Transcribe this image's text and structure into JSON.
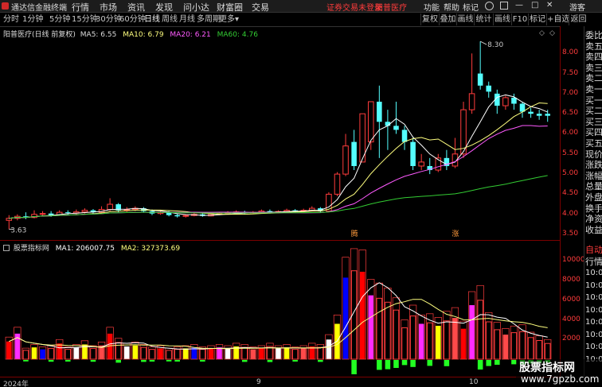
{
  "topbar": {
    "app_title": "通达信金融终端",
    "menu": [
      "行情",
      "市场",
      "资讯",
      "发现",
      "问小达",
      "财富圈",
      "交易"
    ],
    "login_status": "证券交易未登录",
    "stock_name": "阳普医疗",
    "right_menu": [
      "功能",
      "帮助",
      "标记"
    ],
    "guest": "游客"
  },
  "periodbar": {
    "periods": [
      "分时",
      "1分钟",
      "5分钟",
      "15分钟",
      "30分钟",
      "60分钟",
      "日线",
      "周线",
      "月线",
      "多周期",
      "更多"
    ],
    "active": "日线",
    "tools": [
      "复权",
      "叠加",
      "画线",
      "统计",
      "画线",
      "F10",
      "标记",
      "+自选",
      "返回"
    ]
  },
  "main": {
    "header": {
      "title": "阳普医疗(日线 前复权)",
      "ma5": "MA5: 6.55",
      "ma10": "MA10: 6.79",
      "ma20": "MA20: 6.21",
      "ma60": "MA60: 4.76"
    },
    "high_label": "8.30",
    "low_label": "3.63",
    "mark_left": "腾",
    "mark_right": "涨",
    "price_ticks": [
      "8.00",
      "7.50",
      "7.00",
      "6.50",
      "6.00",
      "5.50",
      "5.00",
      "4.50",
      "4.00",
      "3.50"
    ]
  },
  "volume": {
    "header": {
      "title": "股票指标网",
      "ma1": "MA1: 206007.75",
      "ma2": "MA2: 327373.69"
    },
    "ticks": [
      "10000",
      "8000",
      "6000",
      "4000",
      "2000"
    ]
  },
  "right_pane": {
    "labels": [
      "委比",
      "卖五",
      "卖四",
      "卖三",
      "卖二",
      "卖一",
      "买一",
      "买二",
      "买三",
      "买四",
      "买五",
      "现价",
      "涨跌",
      "涨幅",
      "总量",
      "外盘",
      "换手",
      "净资",
      "收益"
    ],
    "auto": "自动",
    "quote": "行情",
    "times": [
      "10:06",
      "10:06",
      "10:06",
      "10:06",
      "10:06",
      "10:06",
      "10:07",
      "10:07"
    ]
  },
  "bottom_axis": {
    "dates": [
      "2024年",
      "9",
      "10"
    ]
  },
  "watermark": {
    "title": "股票指标网",
    "url": "www.7gpzb.com"
  },
  "colors": {
    "up": "#ff3c3c",
    "down": "#54ffff",
    "ma5": "#ffffff",
    "ma10": "#ffff7f",
    "ma20": "#ff5aff",
    "ma60": "#33cc33"
  },
  "chart_data": {
    "type": "candlestick",
    "price_range": [
      3.5,
      8.4
    ],
    "candles": [
      {
        "o": 3.85,
        "c": 3.9,
        "h": 3.98,
        "l": 3.63
      },
      {
        "o": 3.9,
        "c": 3.95,
        "h": 4.0,
        "l": 3.85
      },
      {
        "o": 3.95,
        "c": 3.92,
        "h": 4.05,
        "l": 3.88
      },
      {
        "o": 3.92,
        "c": 4.0,
        "h": 4.1,
        "l": 3.9
      },
      {
        "o": 4.0,
        "c": 4.02,
        "h": 4.08,
        "l": 3.95
      },
      {
        "o": 4.02,
        "c": 3.98,
        "h": 4.08,
        "l": 3.94
      },
      {
        "o": 3.98,
        "c": 4.05,
        "h": 4.1,
        "l": 3.96
      },
      {
        "o": 4.05,
        "c": 4.03,
        "h": 4.1,
        "l": 3.98
      },
      {
        "o": 4.03,
        "c": 4.06,
        "h": 4.12,
        "l": 4.0
      },
      {
        "o": 4.06,
        "c": 4.1,
        "h": 4.15,
        "l": 4.02
      },
      {
        "o": 4.1,
        "c": 4.05,
        "h": 4.13,
        "l": 4.02
      },
      {
        "o": 4.05,
        "c": 4.12,
        "h": 4.2,
        "l": 4.03
      },
      {
        "o": 4.12,
        "c": 4.25,
        "h": 4.4,
        "l": 4.08
      },
      {
        "o": 4.25,
        "c": 4.1,
        "h": 4.28,
        "l": 4.05
      },
      {
        "o": 4.1,
        "c": 4.12,
        "h": 4.18,
        "l": 4.06
      },
      {
        "o": 4.12,
        "c": 4.15,
        "h": 4.2,
        "l": 4.08
      },
      {
        "o": 4.15,
        "c": 4.08,
        "h": 4.18,
        "l": 4.04
      },
      {
        "o": 4.08,
        "c": 4.02,
        "h": 4.12,
        "l": 3.98
      },
      {
        "o": 4.02,
        "c": 4.05,
        "h": 4.1,
        "l": 3.99
      },
      {
        "o": 4.05,
        "c": 3.98,
        "h": 4.08,
        "l": 3.95
      },
      {
        "o": 3.98,
        "c": 3.95,
        "h": 4.02,
        "l": 3.92
      },
      {
        "o": 3.95,
        "c": 3.97,
        "h": 4.0,
        "l": 3.92
      },
      {
        "o": 3.97,
        "c": 4.0,
        "h": 4.05,
        "l": 3.95
      },
      {
        "o": 4.0,
        "c": 3.96,
        "h": 4.03,
        "l": 3.94
      },
      {
        "o": 3.96,
        "c": 4.0,
        "h": 4.05,
        "l": 3.95
      },
      {
        "o": 4.0,
        "c": 4.02,
        "h": 4.06,
        "l": 3.98
      },
      {
        "o": 4.02,
        "c": 4.04,
        "h": 4.08,
        "l": 4.0
      },
      {
        "o": 4.04,
        "c": 4.06,
        "h": 4.1,
        "l": 4.02
      },
      {
        "o": 4.06,
        "c": 4.03,
        "h": 4.09,
        "l": 4.0
      },
      {
        "o": 4.03,
        "c": 4.05,
        "h": 4.08,
        "l": 4.01
      },
      {
        "o": 4.05,
        "c": 4.08,
        "h": 4.12,
        "l": 4.03
      },
      {
        "o": 4.08,
        "c": 4.05,
        "h": 4.12,
        "l": 4.02
      },
      {
        "o": 4.05,
        "c": 4.07,
        "h": 4.1,
        "l": 4.03
      },
      {
        "o": 4.07,
        "c": 4.1,
        "h": 4.14,
        "l": 4.05
      },
      {
        "o": 4.1,
        "c": 4.08,
        "h": 4.13,
        "l": 4.05
      },
      {
        "o": 4.08,
        "c": 4.1,
        "h": 4.14,
        "l": 4.06
      },
      {
        "o": 4.1,
        "c": 4.15,
        "h": 4.2,
        "l": 4.08
      },
      {
        "o": 4.15,
        "c": 4.08,
        "h": 4.18,
        "l": 4.05
      },
      {
        "o": 4.08,
        "c": 4.5,
        "h": 4.55,
        "l": 4.05
      },
      {
        "o": 4.5,
        "c": 5.0,
        "h": 5.05,
        "l": 4.45
      },
      {
        "o": 5.0,
        "c": 5.7,
        "h": 6.0,
        "l": 4.95
      },
      {
        "o": 5.8,
        "c": 5.2,
        "h": 6.1,
        "l": 5.1
      },
      {
        "o": 5.3,
        "c": 6.5,
        "h": 6.5,
        "l": 5.3
      },
      {
        "o": 5.8,
        "c": 6.8,
        "h": 6.8,
        "l": 5.6
      },
      {
        "o": 6.8,
        "c": 6.3,
        "h": 7.2,
        "l": 5.4
      },
      {
        "o": 6.3,
        "c": 6.2,
        "h": 6.6,
        "l": 5.6
      },
      {
        "o": 6.2,
        "c": 6.1,
        "h": 6.8,
        "l": 6.0
      },
      {
        "o": 6.1,
        "c": 5.8,
        "h": 6.2,
        "l": 5.6
      },
      {
        "o": 5.8,
        "c": 5.2,
        "h": 5.9,
        "l": 5.1
      },
      {
        "o": 5.2,
        "c": 5.3,
        "h": 5.5,
        "l": 5.1
      },
      {
        "o": 5.2,
        "c": 5.1,
        "h": 5.4,
        "l": 5.0
      },
      {
        "o": 5.1,
        "c": 5.4,
        "h": 5.5,
        "l": 5.05
      },
      {
        "o": 5.4,
        "c": 5.2,
        "h": 5.6,
        "l": 5.1
      },
      {
        "o": 5.2,
        "c": 5.5,
        "h": 5.9,
        "l": 5.15
      },
      {
        "o": 5.5,
        "c": 6.6,
        "h": 6.8,
        "l": 5.4
      },
      {
        "o": 6.6,
        "c": 7.0,
        "h": 8.0,
        "l": 6.5
      },
      {
        "o": 7.5,
        "c": 7.2,
        "h": 8.3,
        "l": 7.1
      },
      {
        "o": 7.2,
        "c": 7.05,
        "h": 7.3,
        "l": 6.9
      },
      {
        "o": 7.0,
        "c": 6.7,
        "h": 7.1,
        "l": 6.5
      },
      {
        "o": 6.7,
        "c": 6.9,
        "h": 6.95,
        "l": 6.6
      },
      {
        "o": 6.9,
        "c": 6.75,
        "h": 7.0,
        "l": 6.6
      },
      {
        "o": 6.75,
        "c": 6.55,
        "h": 6.8,
        "l": 6.4
      },
      {
        "o": 6.55,
        "c": 6.5,
        "h": 6.65,
        "l": 6.4
      },
      {
        "o": 6.5,
        "c": 6.45,
        "h": 6.6,
        "l": 6.35
      },
      {
        "o": 6.5,
        "c": 6.45,
        "h": 6.6,
        "l": 6.3
      }
    ],
    "volumes": [
      1800,
      2600,
      900,
      1200,
      1000,
      1100,
      1600,
      1000,
      1200,
      1500,
      1100,
      1400,
      2600,
      1700,
      1300,
      1400,
      1200,
      1000,
      1100,
      900,
      1000,
      1100,
      1200,
      1000,
      1100,
      1200,
      1100,
      1300,
      1200,
      1000,
      1100,
      1300,
      1100,
      1200,
      1000,
      1100,
      1300,
      1200,
      2000,
      3600,
      8300,
      9000,
      8900,
      6500,
      6200,
      5800,
      5000,
      3200,
      4400,
      3600,
      3700,
      3400,
      3900,
      4200,
      3100,
      5500,
      6000,
      3800,
      3000,
      2500,
      2700,
      2800,
      2200,
      1900,
      1600
    ],
    "volume_range": [
      0,
      11000
    ]
  }
}
